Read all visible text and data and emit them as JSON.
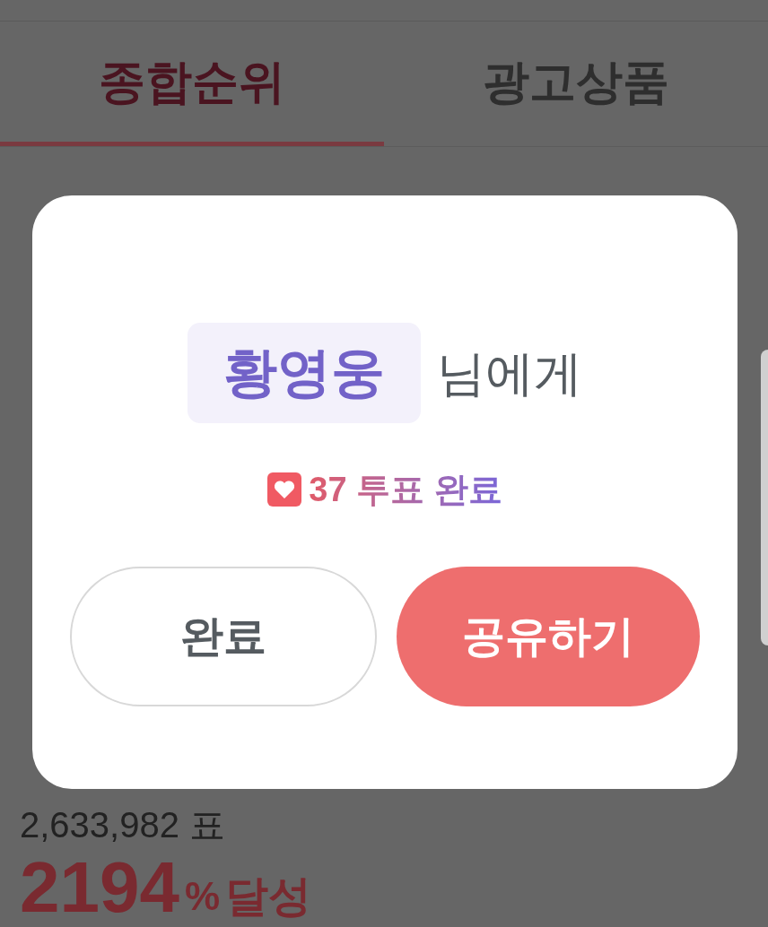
{
  "tabs": [
    {
      "label": "종합순위",
      "selected": true
    },
    {
      "label": "광고상품",
      "selected": false
    }
  ],
  "stats": {
    "votes": "2,633,982 표",
    "percent": "2194",
    "percent_sign": "%",
    "achieved": "달성"
  },
  "dialog": {
    "name": "황영웅",
    "suffix": "님에게",
    "vote_count": "37",
    "vote_text": "투표 완료",
    "buttons": [
      {
        "label": "완료",
        "kind": "secondary"
      },
      {
        "label": "공유하기",
        "kind": "primary"
      }
    ]
  }
}
